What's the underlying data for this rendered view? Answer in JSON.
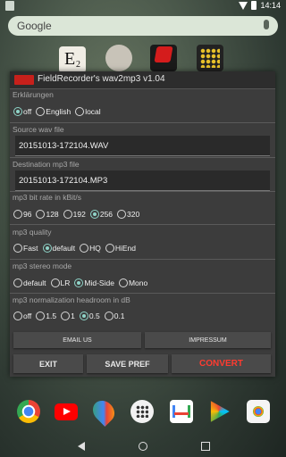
{
  "status_bar": {
    "time": "14:14"
  },
  "search": {
    "label": "Google"
  },
  "home_apps": [
    "E2",
    "portrait",
    "DeutschlandRadio",
    "calculator"
  ],
  "dialog": {
    "title": "FieldRecorder's wav2mp3  v1.04",
    "erklaerungen": {
      "label": "Erklärungen",
      "options": [
        "off",
        "English",
        "local"
      ],
      "selected": "off"
    },
    "source": {
      "label": "Source wav file",
      "value": "20151013-172104.WAV"
    },
    "destination": {
      "label": "Destination mp3 file",
      "value": "20151013-172104.MP3"
    },
    "bitrate": {
      "label": "mp3 bit rate in kBit/s",
      "options": [
        "96",
        "128",
        "192",
        "256",
        "320"
      ],
      "selected": "256"
    },
    "quality": {
      "label": "mp3 quality",
      "options": [
        "Fast",
        "default",
        "HQ",
        "HiEnd"
      ],
      "selected": "default"
    },
    "stereo": {
      "label": "mp3 stereo mode",
      "options": [
        "default",
        "LR",
        "Mid-Side",
        "Mono"
      ],
      "selected": "Mid-Side"
    },
    "headroom": {
      "label": "mp3 normalization headroom in dB",
      "options": [
        "off",
        "1.5",
        "1",
        "0.5",
        "0.1"
      ],
      "selected": "0.5"
    },
    "buttons": {
      "email": "EMAIL US",
      "impressum": "IMPRESSUM",
      "exit": "EXIT",
      "save_pref": "SAVE PREF",
      "convert": "CONVERT"
    }
  },
  "dock": [
    "chrome-icon",
    "youtube-icon",
    "maps-icon",
    "app-drawer-icon",
    "gmail-icon",
    "play-store-icon",
    "camera-icon"
  ],
  "colors": {
    "accent": "#8fd4c8",
    "convert": "#ff3b30"
  }
}
